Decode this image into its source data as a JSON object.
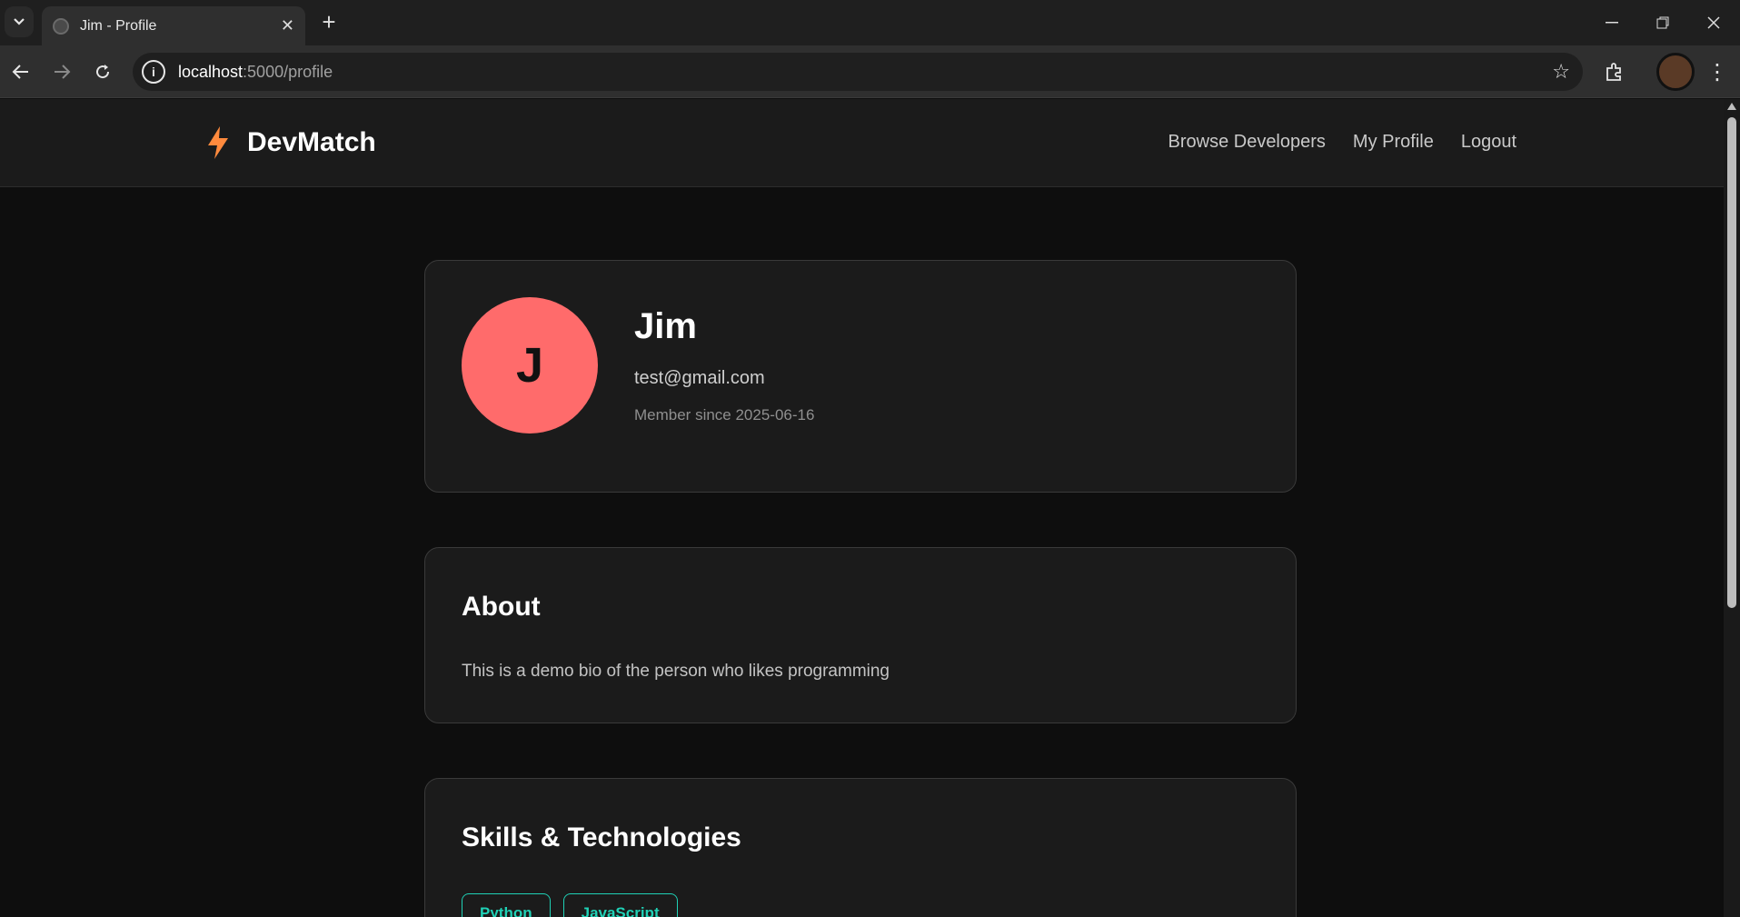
{
  "browser": {
    "tab_title": "Jim - Profile",
    "url_host": "localhost",
    "url_path": ":5000/profile"
  },
  "site": {
    "brand": "DevMatch",
    "brand_color": "#ff8a3d",
    "nav": [
      "Browse Developers",
      "My Profile",
      "Logout"
    ]
  },
  "profile": {
    "initial": "J",
    "name": "Jim",
    "email": "test@gmail.com",
    "member_since": "Member since 2025-06-16",
    "avatar_color": "#ff6b6b"
  },
  "about": {
    "heading": "About",
    "bio": "This is a demo bio of the person who likes programming"
  },
  "skills": {
    "heading": "Skills & Technologies",
    "items": [
      "Python",
      "JavaScript"
    ],
    "chip_color": "#1fd1b6"
  }
}
